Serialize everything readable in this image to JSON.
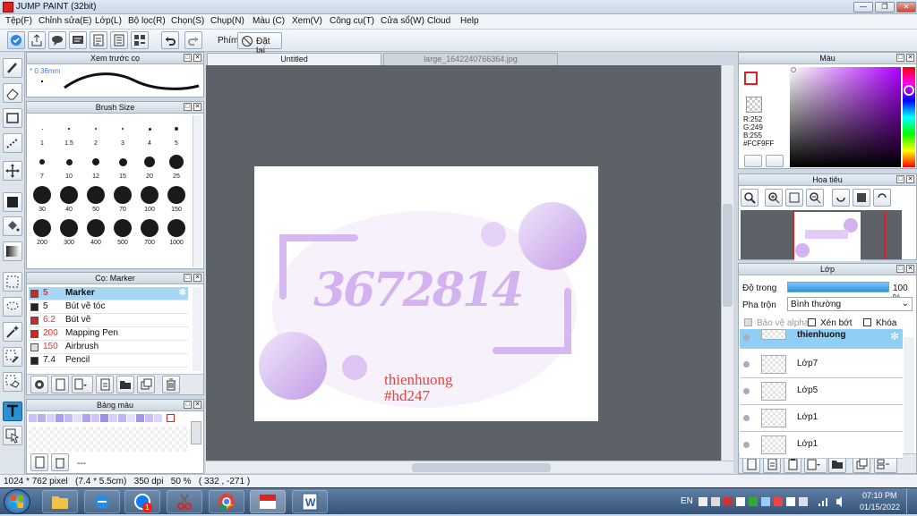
{
  "window": {
    "title": "JUMP PAINT (32bit)",
    "min": "—",
    "max": "❐",
    "close": "✕"
  },
  "menu": [
    "Tệp(F)",
    "Chỉnh sửa(E)",
    "Lớp(L)",
    "Bộ lọc(R)",
    "Chọn(S)",
    "Chụp(N)",
    "Màu (C)",
    "Xem(V)",
    "Công cụ(T)",
    "Cửa sổ(W)",
    "Cloud",
    "Help"
  ],
  "toolbar": {
    "pen_label": "Phím",
    "reset_label": "Đặt lại"
  },
  "tabs": [
    "Untitled",
    "large_1642240766364.jpg"
  ],
  "brush_preview": {
    "title": "Xem trước cọ",
    "size": "* 0.36mm"
  },
  "brush_size": {
    "title": "Brush Size",
    "sizes": [
      "1",
      "1.5",
      "2",
      "3",
      "4",
      "5",
      "7",
      "10",
      "12",
      "15",
      "20",
      "25",
      "30",
      "40",
      "50",
      "70",
      "100",
      "150",
      "200",
      "300",
      "400",
      "500",
      "700",
      "1000"
    ]
  },
  "brushes": {
    "title": "Cọ: Marker",
    "items": [
      {
        "size": "5",
        "name": "Marker",
        "color": "#e02020"
      },
      {
        "size": "5",
        "name": "Bút vẽ tóc",
        "color": "#222222"
      },
      {
        "size": "6.2",
        "name": "Bút vẽ",
        "color": "#e02020"
      },
      {
        "size": "200",
        "name": "Mapping Pen",
        "color": "#e02020"
      },
      {
        "size": "150",
        "name": "Airbrush",
        "color": "#dddddd"
      },
      {
        "size": "7.4",
        "name": "Pencil",
        "color": "#222222"
      }
    ]
  },
  "palette": {
    "title": "Bảng màu",
    "footer": "---",
    "colors": [
      "#c9c3f5",
      "#b9b0ef",
      "#d8d1f8",
      "#a99ce8",
      "#c4bbf3",
      "#e3dcfb",
      "#b0a3ec",
      "#cfc6f6",
      "#9f8fe4",
      "#d6cff7",
      "#bfb4f1",
      "#e6e1fb",
      "#a596e6",
      "#cac0f4",
      "#dcd4f9",
      "#ffffff"
    ]
  },
  "artwork": {
    "number": "3672814",
    "name": "thienhuong",
    "tag": "#hd247"
  },
  "color_panel": {
    "title": "Màu",
    "r": "R:252",
    "g": "G:249",
    "b": "B:255",
    "hex": "#FCF9FF"
  },
  "navigator": {
    "title": "Hoa tiêu"
  },
  "layers": {
    "title": "Lớp",
    "opacity_label": "Độ trong",
    "opacity_value": "100 %",
    "blend_label": "Pha trộn",
    "blend_value": "Bình thường",
    "protect_alpha": "Bảo vệ alpha",
    "clip": "Xén bớt",
    "lock": "Khóa",
    "items": [
      "thienhuong",
      "Lớp7",
      "Lớp5",
      "Lớp1",
      "Lớp1"
    ]
  },
  "status": {
    "text": "1024 * 762 pixel   (7.4 * 5.5cm)   350 dpi   50 %   ( 332 , -271 )"
  },
  "taskbar": {
    "lang": "EN",
    "time": "07:10 PM",
    "date": "01/15/2022",
    "zalo_badge": "1"
  }
}
